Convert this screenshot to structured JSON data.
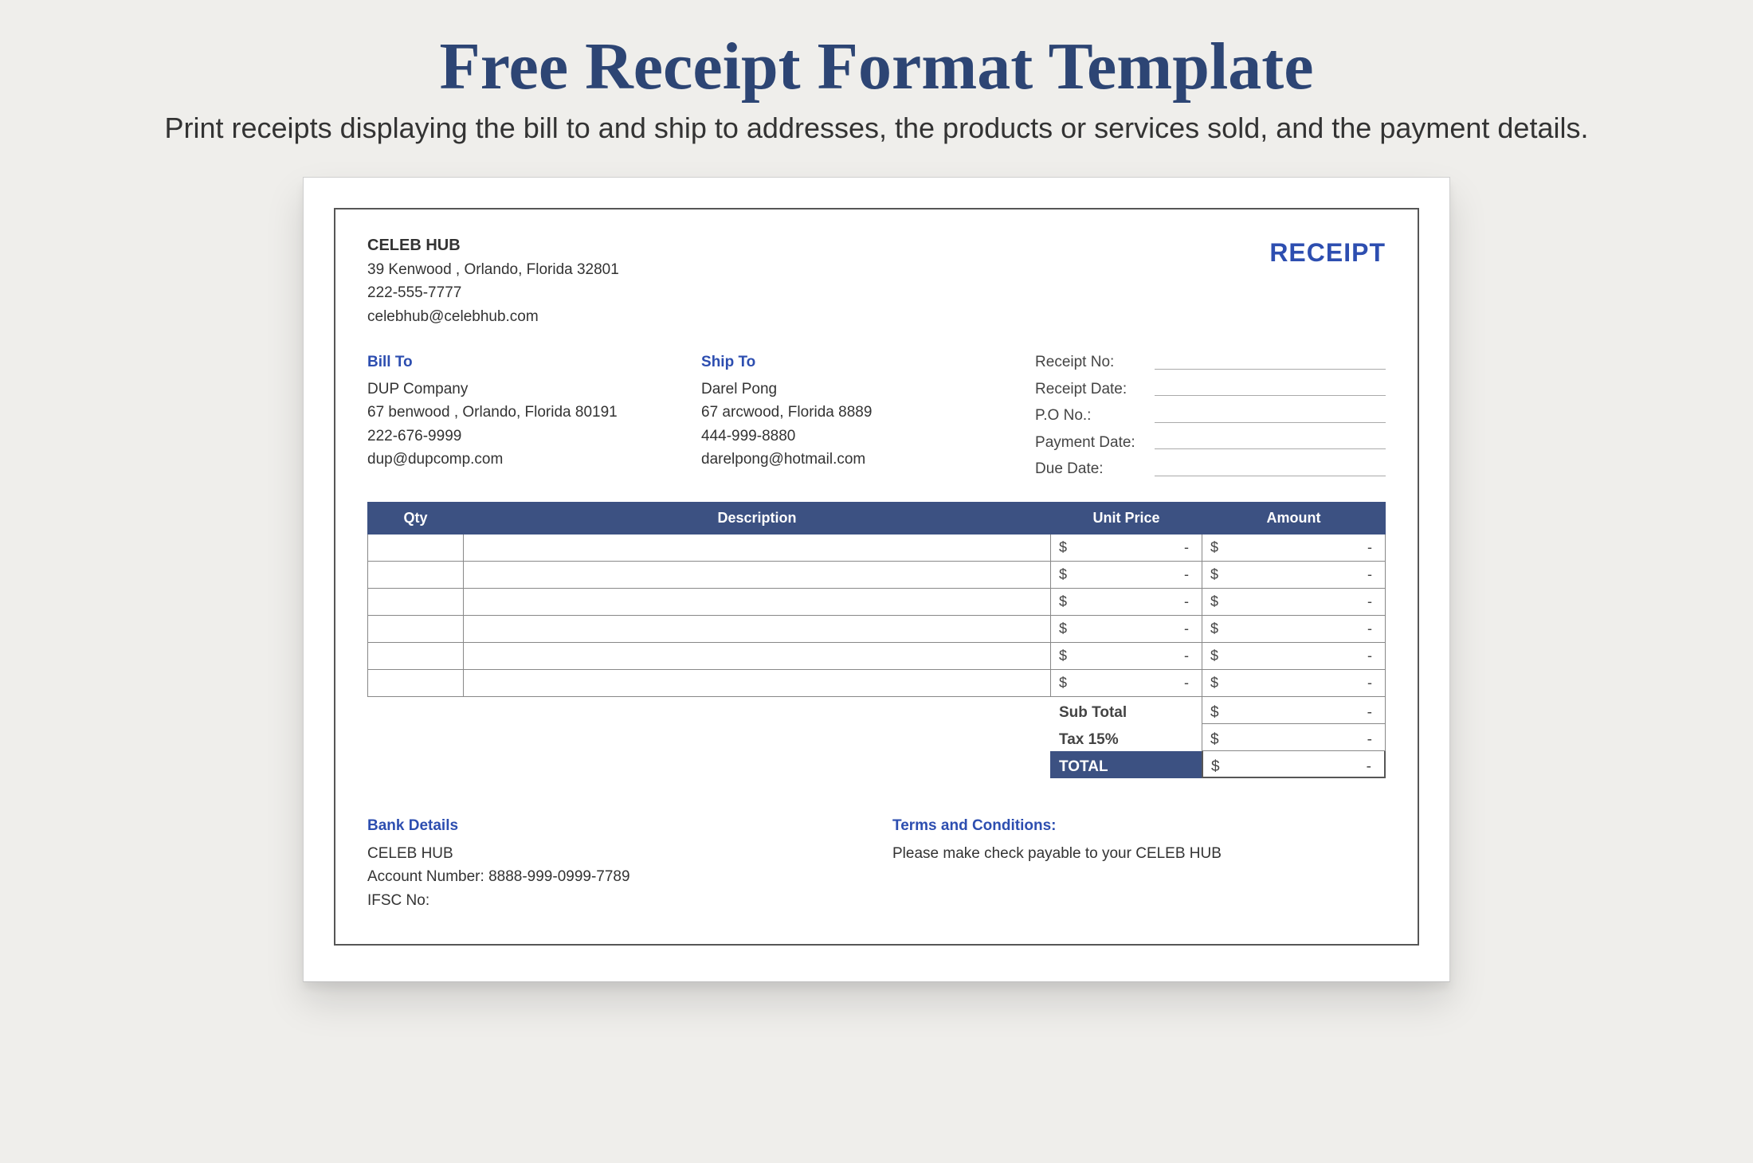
{
  "page": {
    "title": "Free Receipt Format Template",
    "subtitle": "Print receipts displaying the bill to and ship to addresses, the products or services sold, and the payment details."
  },
  "company": {
    "name": "CELEB HUB",
    "address": "39 Kenwood , Orlando, Florida 32801",
    "phone": "222-555-7777",
    "email": "celebhub@celebhub.com"
  },
  "receiptWord": "RECEIPT",
  "billTo": {
    "heading": "Bill To",
    "name": "DUP Company",
    "address": "67 benwood , Orlando, Florida 80191",
    "phone": "222-676-9999",
    "email": "dup@dupcomp.com"
  },
  "shipTo": {
    "heading": "Ship To",
    "name": "Darel Pong",
    "address": "67 arcwood, Florida 8889",
    "phone": "444-999-8880",
    "email": "darelpong@hotmail.com"
  },
  "meta": {
    "receiptNo": "Receipt No:",
    "receiptDate": "Receipt Date:",
    "poNo": "P.O No.:",
    "paymentDate": "Payment Date:",
    "dueDate": "Due Date:"
  },
  "columns": {
    "qty": "Qty",
    "description": "Description",
    "unitPrice": "Unit Price",
    "amount": "Amount"
  },
  "currency": "$",
  "empty": "-",
  "totals": {
    "subtotal": "Sub Total",
    "tax": "Tax 15%",
    "total": "TOTAL"
  },
  "bank": {
    "heading": "Bank Details",
    "name": "CELEB HUB",
    "account": "Account Number: 8888-999-0999-7789",
    "ifsc": "IFSC No:"
  },
  "terms": {
    "heading": "Terms and Conditions:",
    "text": "Please make check payable to your CELEB HUB"
  }
}
